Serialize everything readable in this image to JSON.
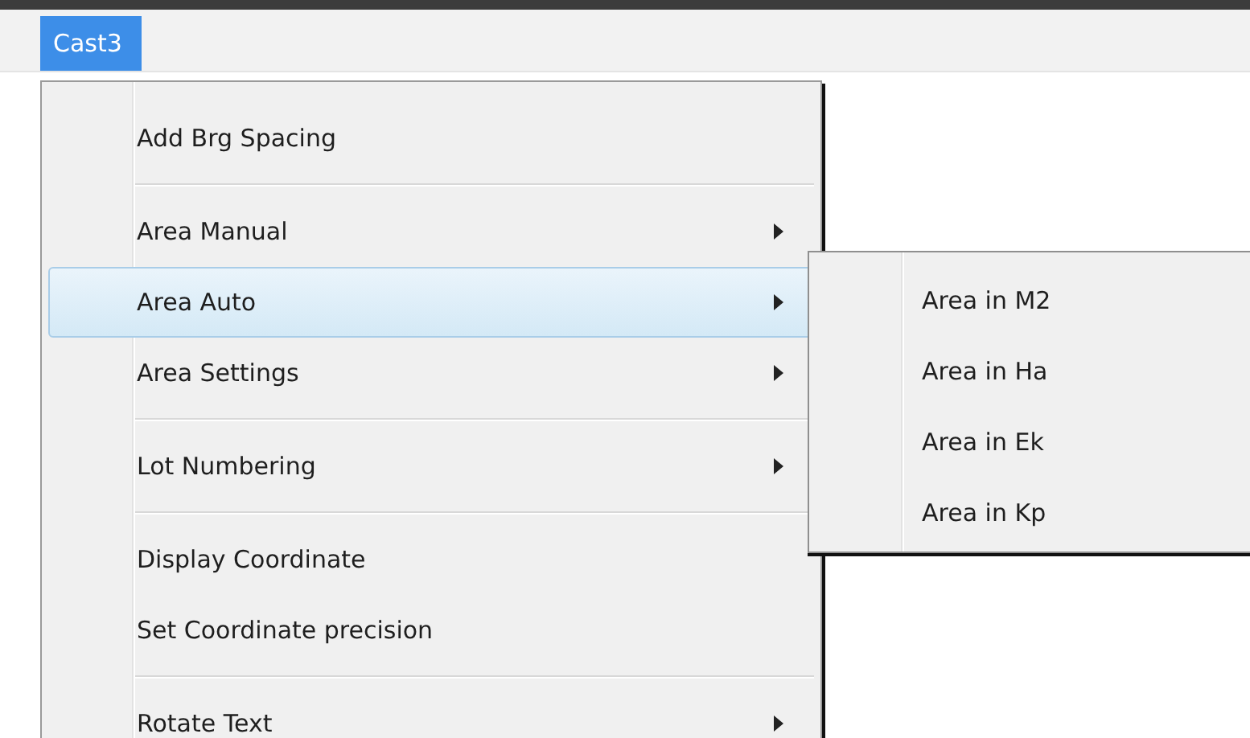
{
  "menubar": {
    "items": [
      {
        "label": "Cast3",
        "selected": true
      }
    ]
  },
  "menu": {
    "items": [
      {
        "kind": "item",
        "label": "Add Brg Spacing",
        "submenu": false,
        "selected": false
      },
      {
        "kind": "separator"
      },
      {
        "kind": "item",
        "label": "Area Manual",
        "submenu": true,
        "selected": false
      },
      {
        "kind": "item",
        "label": "Area Auto",
        "submenu": true,
        "selected": true
      },
      {
        "kind": "item",
        "label": "Area Settings",
        "submenu": true,
        "selected": false
      },
      {
        "kind": "separator"
      },
      {
        "kind": "item",
        "label": "Lot Numbering",
        "submenu": true,
        "selected": false
      },
      {
        "kind": "separator"
      },
      {
        "kind": "item",
        "label": "Display Coordinate",
        "submenu": false,
        "selected": false
      },
      {
        "kind": "item",
        "label": "Set Coordinate precision",
        "submenu": false,
        "selected": false
      },
      {
        "kind": "separator"
      },
      {
        "kind": "item",
        "label": "Rotate Text",
        "submenu": true,
        "selected": false
      }
    ]
  },
  "submenu": {
    "items": [
      {
        "label": "Area in M2",
        "selected": false
      },
      {
        "label": "Area in Ha",
        "selected": false
      },
      {
        "label": "Area in Ek",
        "selected": false
      },
      {
        "label": "Area in Kp",
        "selected": false
      }
    ]
  }
}
